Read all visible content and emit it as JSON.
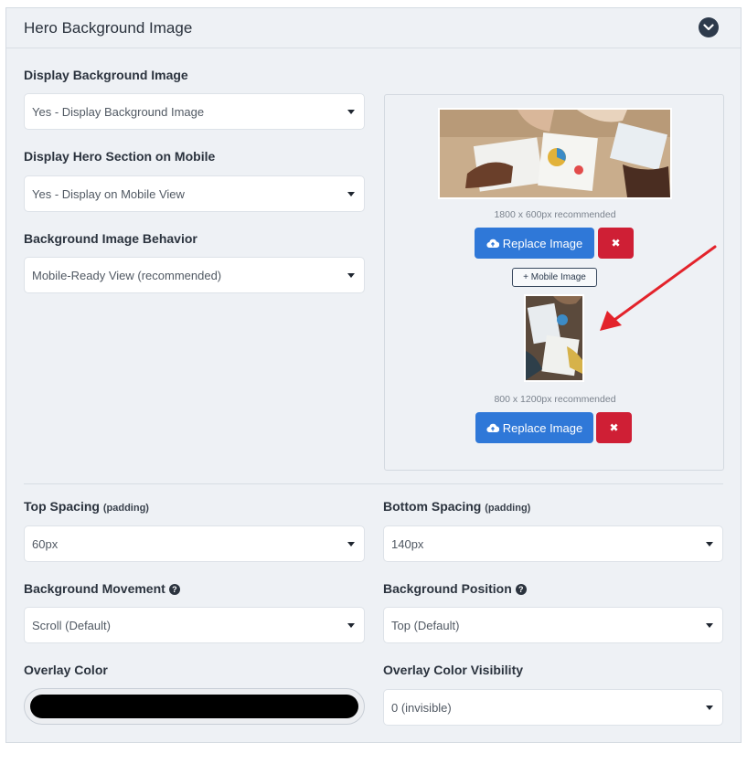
{
  "panel": {
    "title": "Hero Background Image",
    "collapse_icon": "chevron-down-icon"
  },
  "display_bg": {
    "label": "Display Background Image",
    "value": "Yes - Display Background Image"
  },
  "display_mobile": {
    "label": "Display Hero Section on Mobile",
    "value": "Yes - Display on Mobile View"
  },
  "behavior": {
    "label": "Background Image Behavior",
    "value": "Mobile-Ready View (recommended)"
  },
  "images": {
    "desktop_hint": "1800 x 600px recommended",
    "replace_label": "Replace Image",
    "remove_label": "✖",
    "mobile_button": "+ Mobile Image",
    "mobile_hint": "800 x 1200px recommended",
    "upload_icon": "cloud-upload-icon"
  },
  "top_spacing": {
    "label": "Top Spacing",
    "sub": "(padding)",
    "value": "60px"
  },
  "bottom_spacing": {
    "label": "Bottom Spacing",
    "sub": "(padding)",
    "value": "140px"
  },
  "movement": {
    "label": "Background Movement",
    "value": "Scroll (Default)"
  },
  "position": {
    "label": "Background Position",
    "value": "Top (Default)"
  },
  "overlay": {
    "label": "Overlay Color",
    "color": "#000000"
  },
  "overlay_visibility": {
    "label": "Overlay Color Visibility",
    "value": "0 (invisible)"
  },
  "colors": {
    "primary": "#2f78d8",
    "danger": "#cf1f35",
    "annotation_arrow": "#e3232b"
  }
}
